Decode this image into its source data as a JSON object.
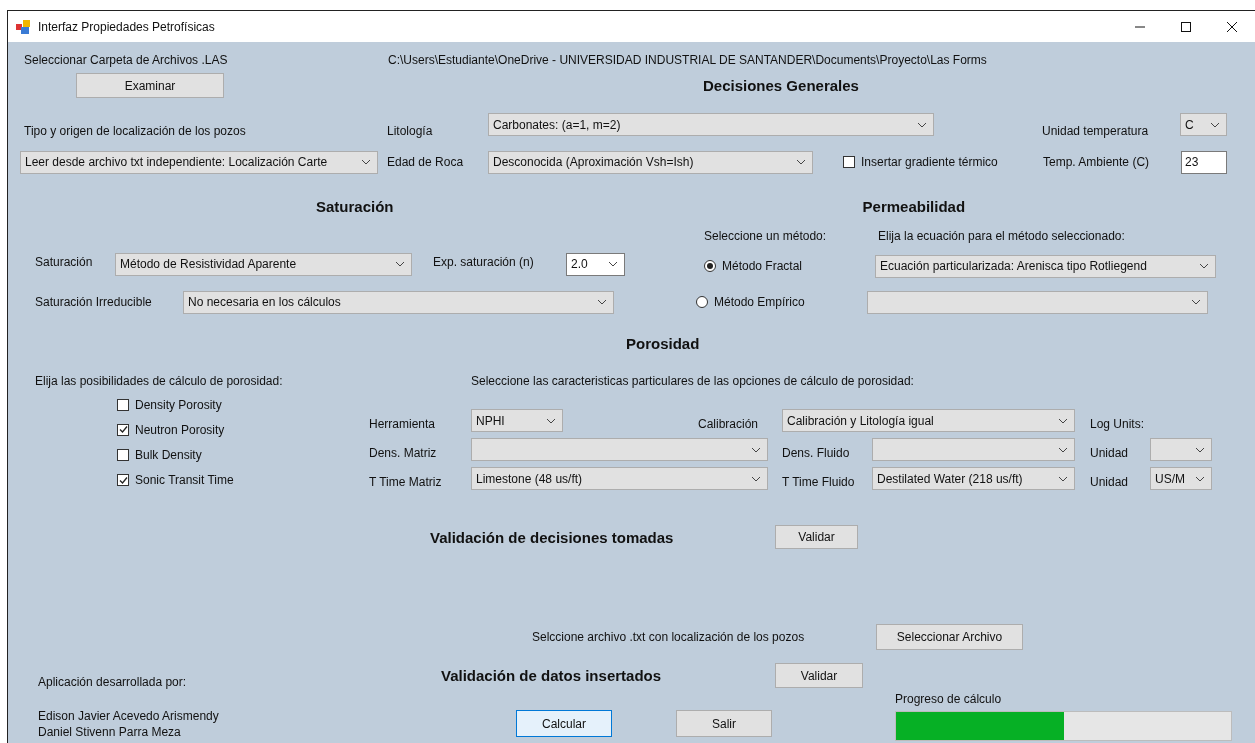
{
  "window": {
    "title": "Interfaz Propiedades Petrofísicas"
  },
  "folder": {
    "label": "Seleccionar Carpeta de Archivos .LAS",
    "path": "C:\\Users\\Estudiante\\OneDrive - UNIVERSIDAD INDUSTRIAL DE SANTANDER\\Documents\\Proyecto\\Las Forms",
    "button": "Examinar"
  },
  "general": {
    "title": "Decisiones Generales",
    "location_label": "Tipo y origen de localización de los pozos",
    "location_value": "Leer desde archivo txt independiente: Localización Carte",
    "lithology_label": "Litología",
    "lithology_value": "Carbonates: (a=1, m=2)",
    "rock_age_label": "Edad de Roca",
    "rock_age_value": "Desconocida (Aproximación Vsh=Ish)",
    "gradient": {
      "label": "Insertar gradiente térmico",
      "checked": false
    },
    "temp_unit_label": "Unidad temperatura",
    "temp_unit_value": "C",
    "ambient_label": "Temp. Ambiente (C)",
    "ambient_value": "23"
  },
  "saturation": {
    "title": "Saturación",
    "method_label": "Saturación",
    "method_value": "Método de Resistividad Aparente",
    "exponent_label": "Exp.  saturación (n)",
    "exponent_value": "2.0",
    "irreducible_label": "Saturación Irreducible",
    "irreducible_value": "No necesaria en los cálculos"
  },
  "permeability": {
    "title": "Permeabilidad",
    "method_prompt": "Seleccione un método:",
    "equation_prompt": "Elija la ecuación para el método seleccionado:",
    "methods": [
      {
        "label": "Método Fractal",
        "selected": true
      },
      {
        "label": "Método Empírico",
        "selected": false
      }
    ],
    "equation_value": "Ecuación particularizada: Arenisca tipo Rotliegend"
  },
  "porosity": {
    "title": "Porosidad",
    "options_prompt": "Elija las posibilidades de cálculo de porosidad:",
    "details_prompt": "Seleccione las caracteristicas particulares de las opciones de cálculo de porosidad:",
    "options": [
      {
        "label": "Density Porosity",
        "checked": false
      },
      {
        "label": "Neutron Porosity",
        "checked": true
      },
      {
        "label": "Bulk Density",
        "checked": false
      },
      {
        "label": "Sonic Transit Time",
        "checked": true
      }
    ],
    "tool_label": "Herramienta",
    "tool_value": "NPHI",
    "calibration_label": "Calibración",
    "calibration_value": "Calibración y Litología igual",
    "log_units_label": "Log Units:",
    "matrix_density_label": "Dens. Matriz",
    "fluid_density_label": "Dens. Fluido",
    "unit_label_1": "Unidad",
    "matrix_time_label": "T Time Matriz",
    "matrix_time_value": "Limestone (48 us/ft)",
    "fluid_time_label": "T Time Fluido",
    "fluid_time_value": "Destilated Water (218 us/ft)",
    "unit_label_2": "Unidad",
    "unit_value_2": "US/M"
  },
  "decisions": {
    "title": "Validación de decisiones tomadas",
    "button": "Validar"
  },
  "file": {
    "label": "Selccione archivo .txt con localización de los pozos",
    "button": "Seleccionar Archivo"
  },
  "data_validation": {
    "title": "Validación de datos insertados",
    "button": "Validar"
  },
  "credits": {
    "label": "Aplicación desarrollada por:",
    "authors": [
      "Edison Javier Acevedo Arismendy",
      "Daniel Stivenn Parra Meza"
    ]
  },
  "actions": [
    {
      "label": "Calcular",
      "focused": true
    },
    {
      "label": "Salir",
      "focused": false
    }
  ],
  "progress": {
    "label": "Progreso de cálculo",
    "level": 0.5
  }
}
